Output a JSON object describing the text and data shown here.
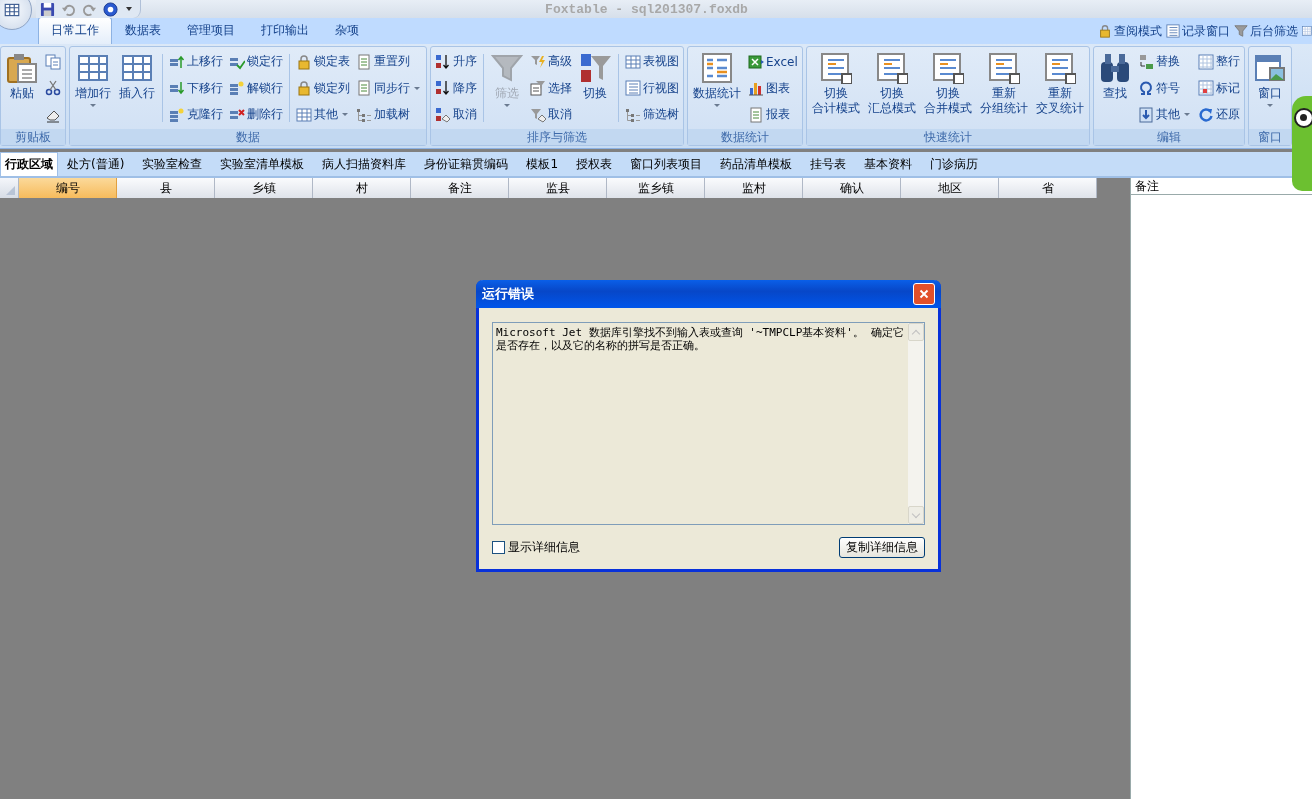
{
  "title_bar": {
    "title": "Foxtable - sql201307.foxdb"
  },
  "ribbon_tabs": [
    {
      "label": "日常工作",
      "selected": true
    },
    {
      "label": "数据表",
      "selected": false
    },
    {
      "label": "管理项目",
      "selected": false
    },
    {
      "label": "打印输出",
      "selected": false
    },
    {
      "label": "杂项",
      "selected": false
    }
  ],
  "ribbon_shortcuts": [
    {
      "label": "查阅模式"
    },
    {
      "label": "记录窗口"
    },
    {
      "label": "后台筛选"
    }
  ],
  "ribbon_groups": [
    {
      "label": "剪贴板",
      "columns": [
        {
          "kind": "large",
          "items": [
            {
              "label": "粘贴",
              "dropdown": false,
              "disabled": false
            }
          ]
        },
        {
          "kind": "small",
          "items": [
            {
              "dropdown": false,
              "disabled": false
            },
            {
              "dropdown": false,
              "disabled": false
            },
            {
              "dropdown": false,
              "disabled": false
            }
          ]
        }
      ]
    },
    {
      "label": "数据",
      "columns": [
        {
          "kind": "large",
          "items": [
            {
              "label": "增加行",
              "dropdown": true,
              "disabled": false
            }
          ]
        },
        {
          "kind": "large",
          "items": [
            {
              "label": "插入行",
              "dropdown": false,
              "disabled": false
            }
          ]
        },
        {
          "kind": "separator"
        },
        {
          "kind": "small",
          "items": [
            {
              "label": "上移行",
              "dropdown": false,
              "disabled": false
            },
            {
              "label": "下移行",
              "dropdown": false,
              "disabled": false
            },
            {
              "label": "克隆行",
              "dropdown": false,
              "disabled": false
            }
          ]
        },
        {
          "kind": "small",
          "items": [
            {
              "label": "锁定行",
              "dropdown": false,
              "disabled": false
            },
            {
              "label": "解锁行",
              "dropdown": false,
              "disabled": false
            },
            {
              "label": "删除行",
              "dropdown": false,
              "disabled": false
            }
          ]
        },
        {
          "kind": "separator"
        },
        {
          "kind": "small",
          "items": [
            {
              "label": "锁定表",
              "dropdown": false,
              "disabled": false
            },
            {
              "label": "锁定列",
              "dropdown": false,
              "disabled": false
            },
            {
              "label": "其他",
              "dropdown": true,
              "disabled": false
            }
          ]
        },
        {
          "kind": "small",
          "items": [
            {
              "label": "重置列",
              "dropdown": false,
              "disabled": false
            },
            {
              "label": "同步行",
              "dropdown": true,
              "disabled": false
            },
            {
              "label": "加载树",
              "dropdown": false,
              "disabled": false
            }
          ]
        }
      ]
    },
    {
      "label": "排序与筛选",
      "columns": [
        {
          "kind": "small",
          "items": [
            {
              "label": "升序",
              "dropdown": false,
              "disabled": false
            },
            {
              "label": "降序",
              "dropdown": false,
              "disabled": false
            },
            {
              "label": "取消",
              "dropdown": false,
              "disabled": false
            }
          ]
        },
        {
          "kind": "separator"
        },
        {
          "kind": "large",
          "items": [
            {
              "label": "筛选",
              "dropdown": true,
              "disabled": true
            }
          ]
        },
        {
          "kind": "small",
          "items": [
            {
              "label": "高级",
              "dropdown": false,
              "disabled": false
            },
            {
              "label": "选择",
              "dropdown": false,
              "disabled": false
            },
            {
              "label": "取消",
              "dropdown": false,
              "disabled": false
            }
          ]
        },
        {
          "kind": "large",
          "items": [
            {
              "label": "切换",
              "dropdown": false,
              "disabled": false
            }
          ]
        },
        {
          "kind": "separator"
        },
        {
          "kind": "small",
          "items": [
            {
              "label": "表视图",
              "dropdown": false,
              "disabled": false
            },
            {
              "label": "行视图",
              "dropdown": false,
              "disabled": false
            },
            {
              "label": "筛选树",
              "dropdown": false,
              "disabled": false
            }
          ]
        }
      ]
    },
    {
      "label": "数据统计",
      "columns": [
        {
          "kind": "large",
          "items": [
            {
              "label": "数据统计",
              "dropdown": true,
              "disabled": false
            }
          ]
        },
        {
          "kind": "small",
          "items": [
            {
              "label": "Excel",
              "dropdown": false,
              "disabled": false
            },
            {
              "label": "图表",
              "dropdown": false,
              "disabled": false
            },
            {
              "label": "报表",
              "dropdown": false,
              "disabled": false
            }
          ]
        }
      ]
    },
    {
      "label": "快速统计",
      "columns": [
        {
          "kind": "large",
          "items": [
            {
              "lines": [
                "切换",
                "合计模式"
              ],
              "dropdown": false,
              "disabled": false
            }
          ]
        },
        {
          "kind": "large",
          "items": [
            {
              "lines": [
                "切换",
                "汇总模式"
              ],
              "dropdown": false,
              "disabled": false
            }
          ]
        },
        {
          "kind": "large",
          "items": [
            {
              "lines": [
                "切换",
                "合并模式"
              ],
              "dropdown": false,
              "disabled": false
            }
          ]
        },
        {
          "kind": "large",
          "items": [
            {
              "lines": [
                "重新",
                "分组统计"
              ],
              "dropdown": false,
              "disabled": false
            }
          ]
        },
        {
          "kind": "large",
          "items": [
            {
              "lines": [
                "重新",
                "交叉统计"
              ],
              "dropdown": false,
              "disabled": false
            }
          ]
        }
      ]
    },
    {
      "label": "编辑",
      "columns": [
        {
          "kind": "large",
          "items": [
            {
              "label": "查找",
              "dropdown": false,
              "disabled": false
            }
          ]
        },
        {
          "kind": "small",
          "items": [
            {
              "label": "替换",
              "dropdown": false,
              "disabled": false
            },
            {
              "label": "符号",
              "dropdown": false,
              "disabled": false
            },
            {
              "label": "其他",
              "dropdown": true,
              "disabled": false
            }
          ]
        },
        {
          "kind": "small",
          "items": [
            {
              "label": "整行",
              "dropdown": false,
              "disabled": false
            },
            {
              "label": "标记",
              "dropdown": false,
              "disabled": false
            },
            {
              "label": "还原",
              "dropdown": false,
              "disabled": false
            }
          ]
        }
      ]
    },
    {
      "label": "窗口",
      "columns": [
        {
          "kind": "large",
          "items": [
            {
              "label": "窗口",
              "dropdown": true,
              "disabled": false
            }
          ]
        }
      ]
    }
  ],
  "sheet_tabs": [
    {
      "label": "行政区域",
      "selected": true
    },
    {
      "label": "处方(普通)",
      "selected": false
    },
    {
      "label": "实验室检查",
      "selected": false
    },
    {
      "label": "实验室清单模板",
      "selected": false
    },
    {
      "label": "病人扫描资料库",
      "selected": false
    },
    {
      "label": "身份证籍贯编码",
      "selected": false
    },
    {
      "label": "模板1",
      "selected": false
    },
    {
      "label": "授权表",
      "selected": false
    },
    {
      "label": "窗口列表项目",
      "selected": false
    },
    {
      "label": "药品清单模板",
      "selected": false
    },
    {
      "label": "挂号表",
      "selected": false
    },
    {
      "label": "基本资料",
      "selected": false
    },
    {
      "label": "门诊病历",
      "selected": false
    }
  ],
  "grid": {
    "columns": [
      {
        "label": "编号",
        "selected": true
      },
      {
        "label": "县",
        "selected": false
      },
      {
        "label": "乡镇",
        "selected": false
      },
      {
        "label": "村",
        "selected": false
      },
      {
        "label": "备注",
        "selected": false
      },
      {
        "label": "监县",
        "selected": false
      },
      {
        "label": "监乡镇",
        "selected": false
      },
      {
        "label": "监村",
        "selected": false
      },
      {
        "label": "确认",
        "selected": false
      },
      {
        "label": "地区",
        "selected": false
      },
      {
        "label": "省",
        "selected": false
      }
    ]
  },
  "side_panel": {
    "header": "备注"
  },
  "dialog": {
    "title": "运行错误",
    "message": "Microsoft Jet 数据库引擎找不到输入表或查询 '~TMPCLP基本资料'。 确定它是否存在，以及它的名称的拼写是否正确。",
    "show_details": {
      "label": "显示详细信息",
      "checked": false
    },
    "copy_button": "复制详细信息"
  }
}
